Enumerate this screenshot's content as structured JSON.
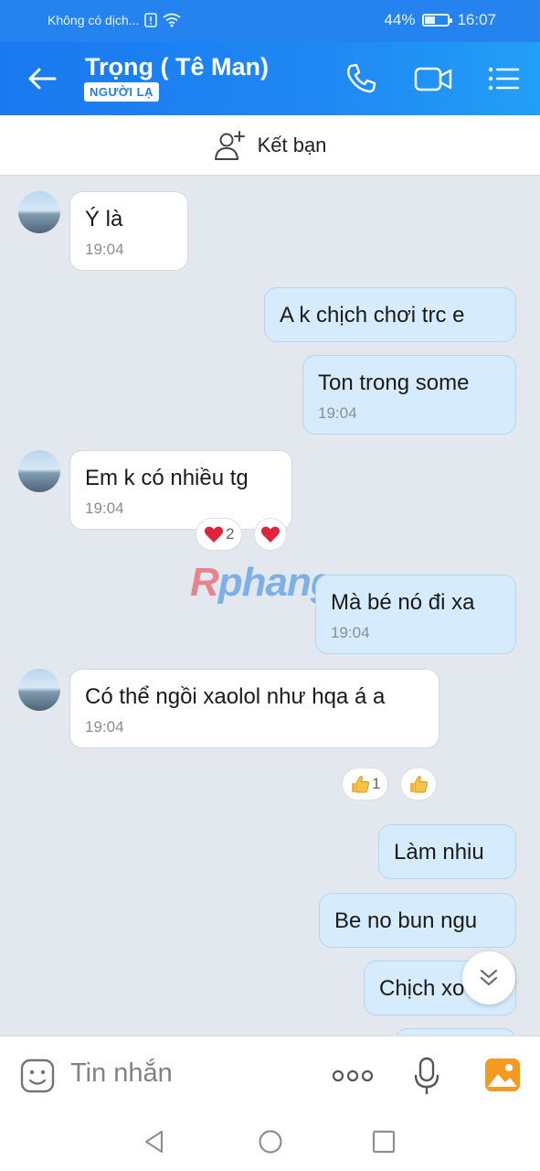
{
  "status": {
    "carrier": "Không có dịch...",
    "battery": "44%",
    "battery_level": 0.44,
    "time": "16:07"
  },
  "header": {
    "title": "Trọng ( Tê Man)",
    "badge": "NGƯỜI LẠ",
    "icons": [
      "back-arrow-icon",
      "phone-icon",
      "video-call-icon",
      "menu-list-icon"
    ]
  },
  "friend_bar": {
    "label": "Kết bạn"
  },
  "messages": [
    {
      "side": "in",
      "text": "Ý là",
      "time": "19:04"
    },
    {
      "side": "out",
      "text": "A k chịch chơi trc e",
      "time": ""
    },
    {
      "side": "out",
      "text": "Ton trong some",
      "time": "19:04"
    },
    {
      "side": "in",
      "text": "Em k có nhiều tg",
      "time": "19:04",
      "reaction": {
        "emoji": "heart",
        "count": "2"
      }
    },
    {
      "side": "out",
      "text": "Mà bé nó đi xa",
      "time": "19:04"
    },
    {
      "side": "in",
      "text": "Có thể ngồi xaolol như hqa á a",
      "time": "19:04",
      "reaction": {
        "emoji": "thumbs-up",
        "count": "1"
      }
    },
    {
      "side": "out",
      "text": "Làm nhiu",
      "time": ""
    },
    {
      "side": "out",
      "text": "Be no bun ngu",
      "time": ""
    },
    {
      "side": "out",
      "text": "Chịch xo",
      "time": ""
    }
  ],
  "watermark": {
    "part1": "R",
    "part2": "phang"
  },
  "input": {
    "placeholder": "Tin nhắn"
  },
  "colors": {
    "header": "#1f88f3",
    "out_bubble": "#d6ecfd",
    "in_bubble": "#ffffff",
    "chat_bg": "#e2e8ee"
  }
}
